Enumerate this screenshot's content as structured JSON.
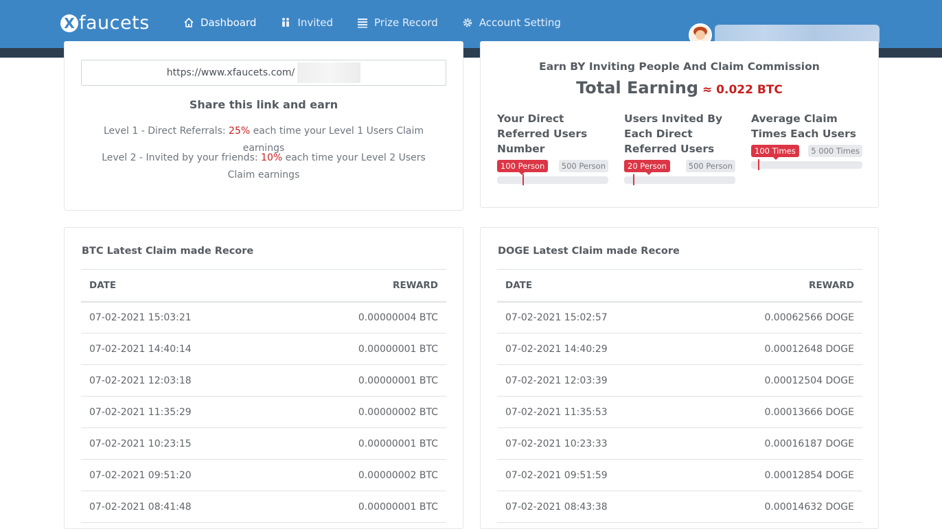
{
  "header": {
    "logo_mark": "X",
    "logo_text": "faucets",
    "nav": [
      {
        "label": "Dashboard",
        "icon": "home-icon",
        "active": true
      },
      {
        "label": "Invited",
        "icon": "people-icon",
        "active": false
      },
      {
        "label": "Prize Record",
        "icon": "list-icon",
        "active": false
      },
      {
        "label": "Account Setting",
        "icon": "gear-icon",
        "active": false
      }
    ],
    "colors": {
      "bar": "#3d86c6",
      "strip": "#2c3e50"
    }
  },
  "referral": {
    "link_prefix": "https://www.xfaucets.com/",
    "share_title": "Share this link and earn",
    "level1_prefix": "Level 1 - Direct Referrals: ",
    "level1_pct": "25%",
    "level1_suffix": " each time your Level 1 Users Claim earnings",
    "level2_prefix": "Level 2 - Invited by your friends: ",
    "level2_pct": "10%",
    "level2_suffix": " each time your Level 2 Users Claim earnings"
  },
  "earnings": {
    "subtitle": "Earn BY Inviting People And Claim Commission",
    "total_label": "Total Earning",
    "total_value": "≈ 0.022 BTC",
    "stats": [
      {
        "title_lines": [
          "Your Direct",
          "Referred Users",
          "Number"
        ],
        "value_label": "100 Person",
        "max_label": "500 Person",
        "fraction": 0.23
      },
      {
        "title_lines": [
          "Users Invited By",
          "Each Direct",
          "Referred Users"
        ],
        "value_label": "20 Person",
        "max_label": "500 Person",
        "fraction": 0.08
      },
      {
        "title_lines": [
          "Average Claim",
          "Times Each Users"
        ],
        "value_label": "100 Times",
        "max_label": "5 000 Times",
        "fraction": 0.06
      }
    ]
  },
  "btc_table": {
    "title": "BTC Latest Claim made Recore",
    "headers": [
      "DATE",
      "REWARD"
    ],
    "rows": [
      [
        "07-02-2021 15:03:21",
        "0.00000004 BTC"
      ],
      [
        "07-02-2021 14:40:14",
        "0.00000001 BTC"
      ],
      [
        "07-02-2021 12:03:18",
        "0.00000001 BTC"
      ],
      [
        "07-02-2021 11:35:29",
        "0.00000002 BTC"
      ],
      [
        "07-02-2021 10:23:15",
        "0.00000001 BTC"
      ],
      [
        "07-02-2021 09:51:20",
        "0.00000002 BTC"
      ],
      [
        "07-02-2021 08:41:48",
        "0.00000001 BTC"
      ]
    ]
  },
  "doge_table": {
    "title": "DOGE Latest Claim made Recore",
    "headers": [
      "DATE",
      "REWARD"
    ],
    "rows": [
      [
        "07-02-2021 15:02:57",
        "0.00062566 DOGE"
      ],
      [
        "07-02-2021 14:40:29",
        "0.00012648 DOGE"
      ],
      [
        "07-02-2021 12:03:39",
        "0.00012504 DOGE"
      ],
      [
        "07-02-2021 11:35:53",
        "0.00013666 DOGE"
      ],
      [
        "07-02-2021 10:23:33",
        "0.00016187 DOGE"
      ],
      [
        "07-02-2021 09:51:59",
        "0.00012854 DOGE"
      ],
      [
        "07-02-2021 08:43:38",
        "0.00014632 DOGE"
      ]
    ]
  }
}
